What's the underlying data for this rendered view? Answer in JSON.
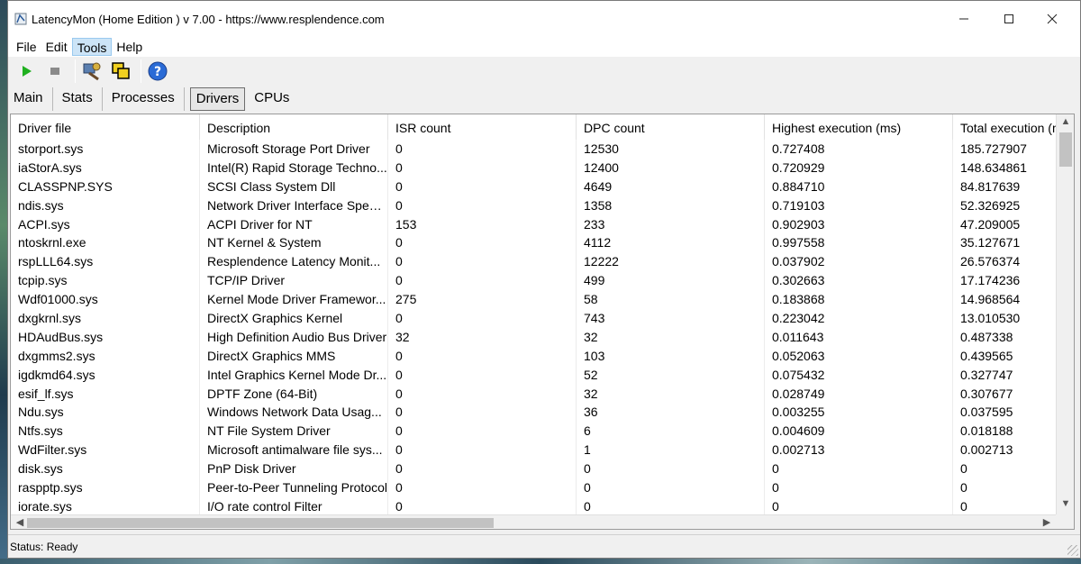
{
  "window": {
    "title": "LatencyMon  (Home Edition )  v 7.00 - https://www.resplendence.com",
    "minimize_icon": "minimize-icon",
    "maximize_icon": "maximize-icon",
    "close_icon": "close-icon"
  },
  "menu": [
    "File",
    "Edit",
    "Tools",
    "Help"
  ],
  "menu_active": "Tools",
  "toolbar": [
    {
      "icon": "play-icon",
      "color": "#20b020"
    },
    {
      "icon": "stop-icon",
      "color": "#8a8a8a"
    },
    {
      "icon": "diagnostics-icon"
    },
    {
      "icon": "windows-icon"
    },
    {
      "icon": "help-icon",
      "color": "#2a6bd6"
    }
  ],
  "tabs": [
    "Main",
    "Stats",
    "Processes",
    "Drivers",
    "CPUs"
  ],
  "active_tab": "Drivers",
  "table": {
    "columns": [
      "Driver file",
      "Description",
      "ISR count",
      "DPC count",
      "Highest execution (ms)",
      "Total execution (m"
    ],
    "rows": [
      [
        "storport.sys",
        "Microsoft Storage Port Driver",
        "0",
        "12530",
        "0.727408",
        "185.727907"
      ],
      [
        "iaStorA.sys",
        "Intel(R) Rapid Storage Techno...",
        "0",
        "12400",
        "0.720929",
        "148.634861"
      ],
      [
        "CLASSPNP.SYS",
        "SCSI Class System Dll",
        "0",
        "4649",
        "0.884710",
        "84.817639"
      ],
      [
        "ndis.sys",
        "Network Driver Interface Speci...",
        "0",
        "1358",
        "0.719103",
        "52.326925"
      ],
      [
        "ACPI.sys",
        "ACPI Driver for NT",
        "153",
        "233",
        "0.902903",
        "47.209005"
      ],
      [
        "ntoskrnl.exe",
        "NT Kernel & System",
        "0",
        "4112",
        "0.997558",
        "35.127671"
      ],
      [
        "rspLLL64.sys",
        "Resplendence Latency Monit...",
        "0",
        "12222",
        "0.037902",
        "26.576374"
      ],
      [
        "tcpip.sys",
        "TCP/IP Driver",
        "0",
        "499",
        "0.302663",
        "17.174236"
      ],
      [
        "Wdf01000.sys",
        "Kernel Mode Driver Framewor...",
        "275",
        "58",
        "0.183868",
        "14.968564"
      ],
      [
        "dxgkrnl.sys",
        "DirectX Graphics Kernel",
        "0",
        "743",
        "0.223042",
        "13.010530"
      ],
      [
        "HDAudBus.sys",
        "High Definition Audio Bus Driver",
        "32",
        "32",
        "0.011643",
        "0.487338"
      ],
      [
        "dxgmms2.sys",
        "DirectX Graphics MMS",
        "0",
        "103",
        "0.052063",
        "0.439565"
      ],
      [
        "igdkmd64.sys",
        "Intel Graphics Kernel Mode Dr...",
        "0",
        "52",
        "0.075432",
        "0.327747"
      ],
      [
        "esif_lf.sys",
        "DPTF Zone (64-Bit)",
        "0",
        "32",
        "0.028749",
        "0.307677"
      ],
      [
        "Ndu.sys",
        "Windows Network Data Usag...",
        "0",
        "36",
        "0.003255",
        "0.037595"
      ],
      [
        "Ntfs.sys",
        "NT File System Driver",
        "0",
        "6",
        "0.004609",
        "0.018188"
      ],
      [
        "WdFilter.sys",
        "Microsoft antimalware file sys...",
        "0",
        "1",
        "0.002713",
        "0.002713"
      ],
      [
        "disk.sys",
        "PnP Disk Driver",
        "0",
        "0",
        "0",
        "0"
      ],
      [
        "raspptp.sys",
        "Peer-to-Peer Tunneling Protocol",
        "0",
        "0",
        "0",
        "0"
      ],
      [
        "iorate.sys",
        "I/O rate control Filter",
        "0",
        "0",
        "0",
        "0"
      ]
    ]
  },
  "status": "Status: Ready"
}
